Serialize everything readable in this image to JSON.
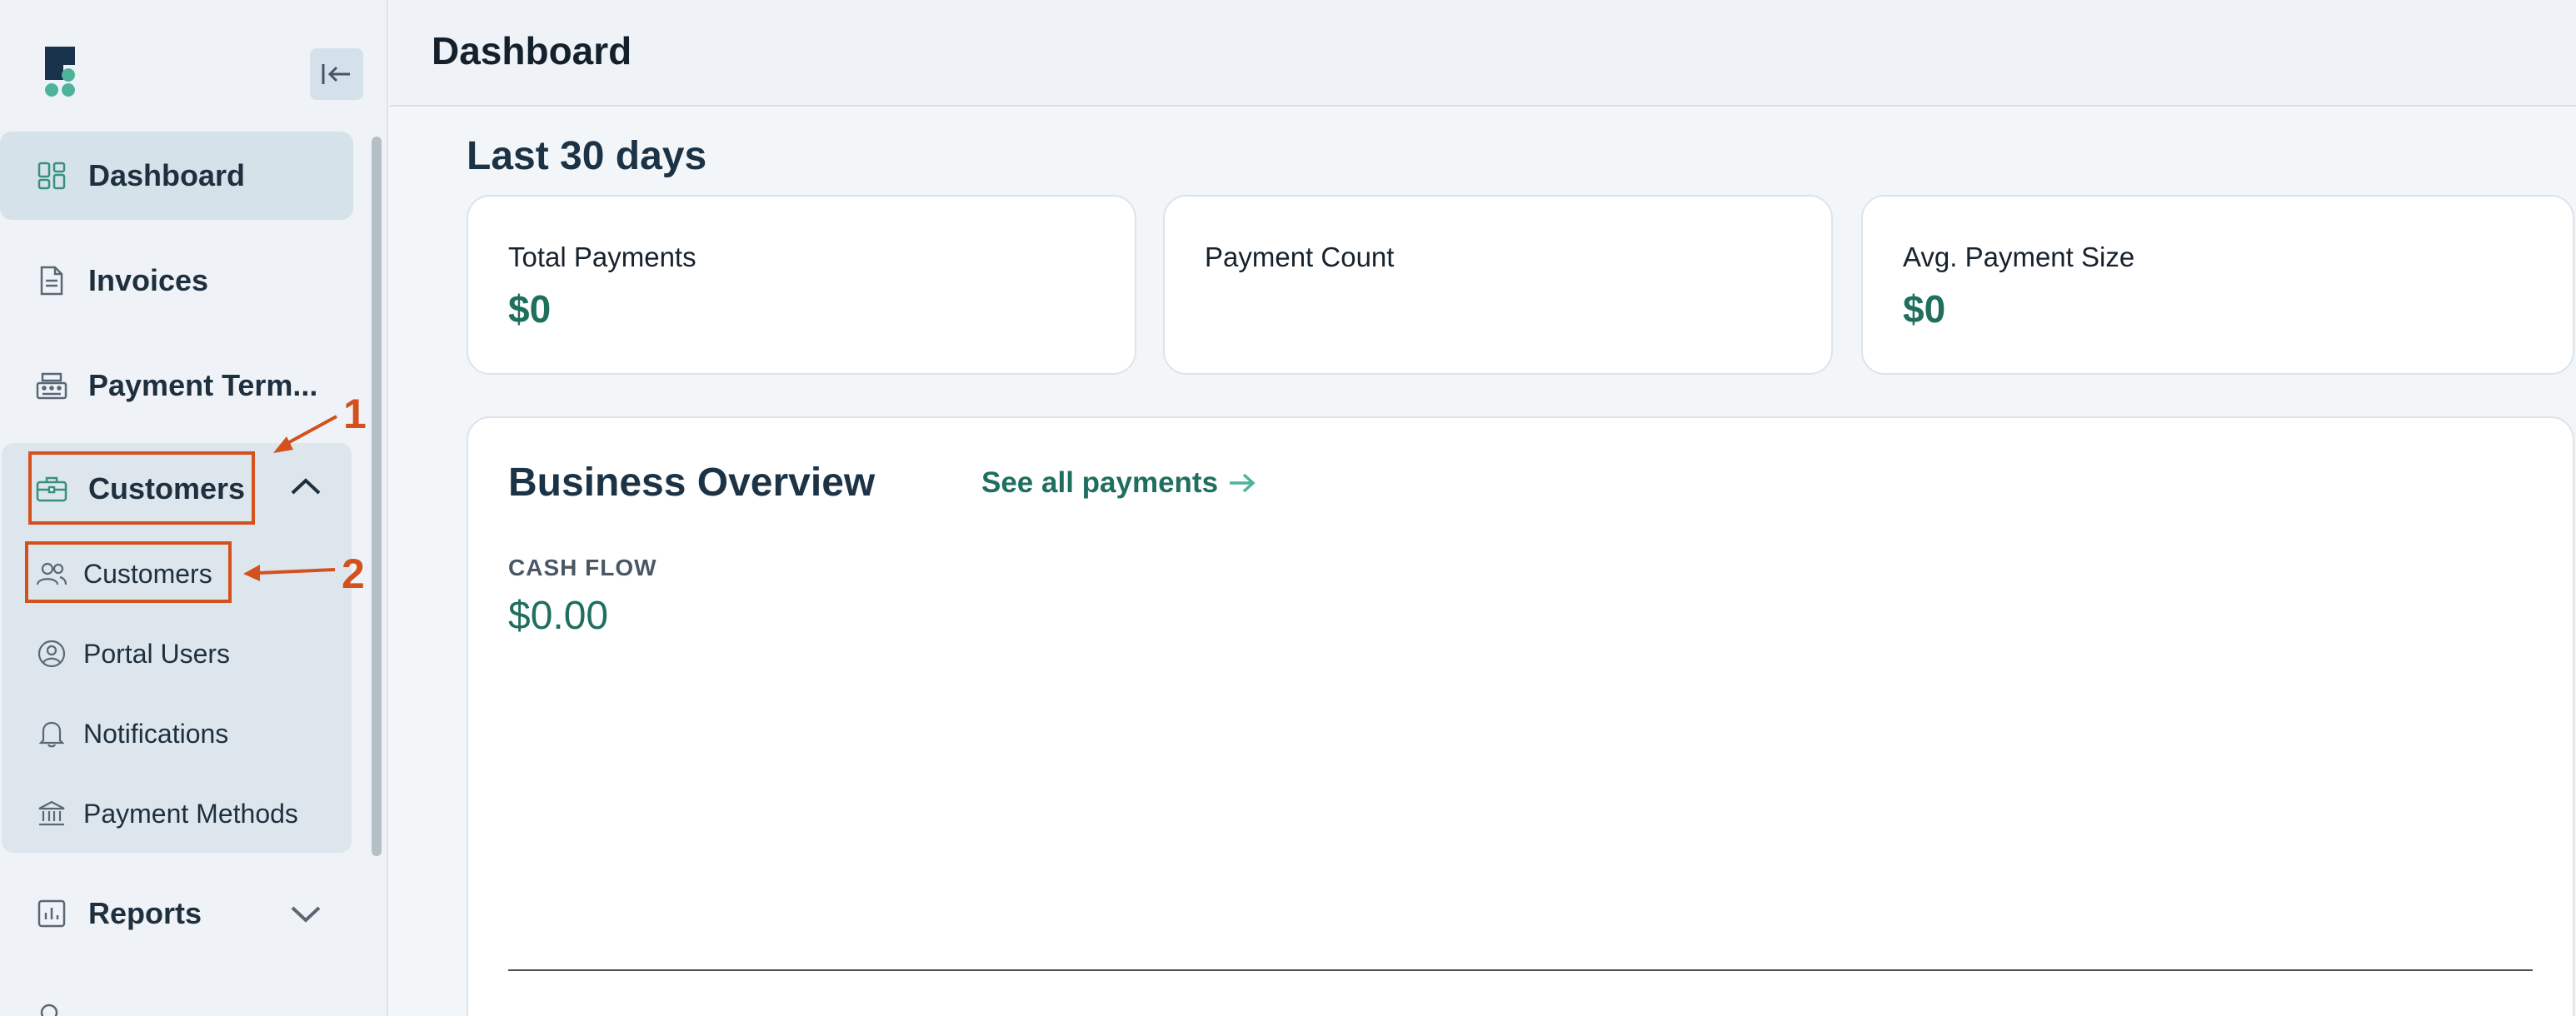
{
  "sidebar": {
    "nav": [
      {
        "label": "Dashboard",
        "icon": "dashboard-grid-icon"
      },
      {
        "label": "Invoices",
        "icon": "document-icon"
      },
      {
        "label": "Payment Term...",
        "icon": "register-icon"
      },
      {
        "label": "Customers",
        "icon": "briefcase-icon"
      },
      {
        "label": "Reports",
        "icon": "chart-icon"
      }
    ],
    "customer_sub": [
      {
        "label": "Customers",
        "icon": "users-icon"
      },
      {
        "label": "Portal Users",
        "icon": "user-circle-icon"
      },
      {
        "label": "Notifications",
        "icon": "bell-icon"
      },
      {
        "label": "Payment Methods",
        "icon": "bank-icon"
      }
    ],
    "annotations": [
      "1",
      "2"
    ]
  },
  "header": {
    "title": "Dashboard"
  },
  "main": {
    "period": "Last 30 days",
    "stats": [
      {
        "label": "Total Payments",
        "value": "$0"
      },
      {
        "label": "Payment Count",
        "value": ""
      },
      {
        "label": "Avg. Payment Size",
        "value": "$0"
      }
    ],
    "overview": {
      "title": "Business Overview",
      "link": "See all payments",
      "cash_flow_label": "CASH FLOW",
      "cash_flow_value": "$0.00"
    }
  },
  "colors": {
    "accent": "#1f6f5f",
    "annotation": "#d4511e",
    "navy": "#17324a"
  }
}
